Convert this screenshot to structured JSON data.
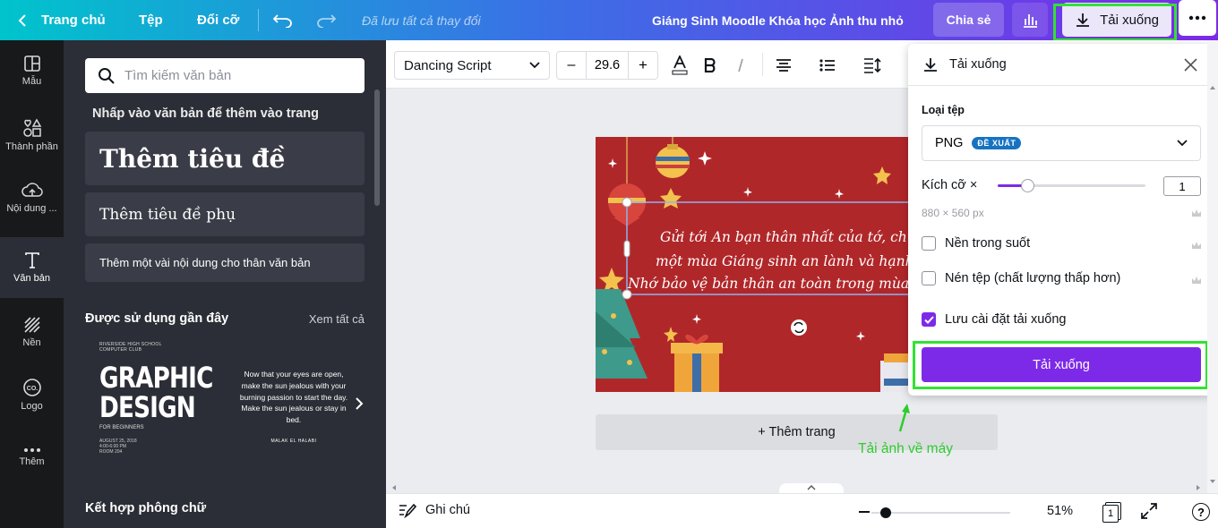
{
  "topbar": {
    "home_label": "Trang chủ",
    "file_label": "Tệp",
    "resize_label": "Đổi cỡ",
    "saved_status": "Đã lưu tất cả thay đổi",
    "doc_title": "Giáng Sinh Moodle Khóa học Ảnh thu nhỏ",
    "share_label": "Chia sẻ",
    "download_label": "Tải xuống"
  },
  "rail": [
    {
      "label": "Mẫu",
      "icon": "layout-icon"
    },
    {
      "label": "Thành phần",
      "icon": "shapes-icon"
    },
    {
      "label": "Nội dung ...",
      "icon": "upload-cloud-icon"
    },
    {
      "label": "Văn bản",
      "icon": "text-icon"
    },
    {
      "label": "Nền",
      "icon": "background-icon"
    },
    {
      "label": "Logo",
      "icon": "logo-icon"
    },
    {
      "label": "Thêm",
      "icon": "more-icon"
    }
  ],
  "panel": {
    "search_placeholder": "Tìm kiếm văn bản",
    "hint": "Nhấp vào văn bản để thêm vào trang",
    "heading": "Thêm tiêu đề",
    "subheading": "Thêm tiêu đề phụ",
    "body": "Thêm một vài nội dung cho thân văn bản",
    "recent_title": "Được sử dụng gần đây",
    "see_all": "Xem tất cả",
    "combo_title": "Kết hợp phông chữ",
    "thumb1": {
      "school": "RIVERSIDE HIGH SCHOOL",
      "club": "COMPUTER CLUB",
      "line1": "GRAPHIC",
      "line2": "DESIGN",
      "sub": "FOR BEGINNERS",
      "date": "AUGUST 25, 2018",
      "time": "4:00-6:00 PM",
      "room": "ROOM 204"
    },
    "thumb2": {
      "quote": "Now that your eyes are open, make the sun jealous with your burning passion to start the day. Make the sun jealous or stay in bed.",
      "author": "MALAK EL HALABI"
    }
  },
  "toolbar": {
    "font": "Dancing Script",
    "size": "29.6",
    "minus": "–",
    "plus": "+"
  },
  "design": {
    "line1": "Gửi tới An bạn thân nhất của tớ, chúc",
    "line2": "một mùa Giáng sinh an lành và hạnh p",
    "line3": "Nhớ bảo vệ bản thân an toàn trong mùa dịc"
  },
  "canvas": {
    "add_page": "+ Thêm trang",
    "annotation": "Tải ảnh về máy"
  },
  "download_popup": {
    "title": "Tải xuống",
    "file_type_label": "Loại tệp",
    "file_type": "PNG",
    "recommended_badge": "ĐỀ XUẤT",
    "size_label": "Kích cỡ ×",
    "size_value": "1",
    "size_level": 0.2,
    "dimensions": "880 × 560 px",
    "transparent_bg": "Nền trong suốt",
    "transparent_bg_checked": false,
    "compress": "Nén tệp (chất lượng thấp hơn)",
    "compress_checked": false,
    "save_settings": "Lưu cài đặt tải xuống",
    "save_settings_checked": true,
    "button": "Tải xuống"
  },
  "bottombar": {
    "notes": "Ghi chú",
    "zoom": "51%",
    "page_count": "1",
    "zoom_level": 0.1
  },
  "colors": {
    "accent": "#7d2ae8",
    "highlight": "#32e232",
    "design_bg": "#b0272a",
    "rail_bg": "#18191b",
    "panel_bg": "#2b2e36"
  }
}
